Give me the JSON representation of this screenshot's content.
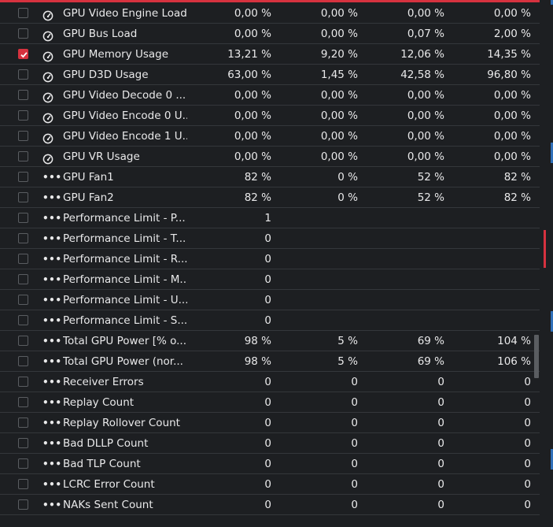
{
  "colors": {
    "accent": "#d6323f",
    "background": "#1d1f22",
    "divider": "#34373b",
    "marker_blue": "#2f6fb8"
  },
  "rows": [
    {
      "checked": false,
      "icon": "gauge-icon",
      "name": "GPU Video Engine Load",
      "v1": "0,00 %",
      "v2": "0,00 %",
      "v3": "0,00 %",
      "v4": "0,00 %"
    },
    {
      "checked": false,
      "icon": "gauge-icon",
      "name": "GPU Bus Load",
      "v1": "0,00 %",
      "v2": "0,00 %",
      "v3": "0,07 %",
      "v4": "2,00 %"
    },
    {
      "checked": true,
      "icon": "gauge-icon",
      "name": "GPU Memory Usage",
      "v1": "13,21 %",
      "v2": "9,20 %",
      "v3": "12,06 %",
      "v4": "14,35 %"
    },
    {
      "checked": false,
      "icon": "gauge-icon",
      "name": "GPU D3D Usage",
      "v1": "63,00 %",
      "v2": "1,45 %",
      "v3": "42,58 %",
      "v4": "96,80 %"
    },
    {
      "checked": false,
      "icon": "gauge-icon",
      "name": "GPU Video Decode 0 ...",
      "v1": "0,00 %",
      "v2": "0,00 %",
      "v3": "0,00 %",
      "v4": "0,00 %"
    },
    {
      "checked": false,
      "icon": "gauge-icon",
      "name": "GPU Video Encode 0 U...",
      "v1": "0,00 %",
      "v2": "0,00 %",
      "v3": "0,00 %",
      "v4": "0,00 %"
    },
    {
      "checked": false,
      "icon": "gauge-icon",
      "name": "GPU Video Encode 1 U...",
      "v1": "0,00 %",
      "v2": "0,00 %",
      "v3": "0,00 %",
      "v4": "0,00 %"
    },
    {
      "checked": false,
      "icon": "gauge-icon",
      "name": "GPU VR Usage",
      "v1": "0,00 %",
      "v2": "0,00 %",
      "v3": "0,00 %",
      "v4": "0,00 %"
    },
    {
      "checked": false,
      "icon": "more-icon",
      "name": "GPU Fan1",
      "v1": "82 %",
      "v2": "0 %",
      "v3": "52 %",
      "v4": "82 %"
    },
    {
      "checked": false,
      "icon": "more-icon",
      "name": "GPU Fan2",
      "v1": "82 %",
      "v2": "0 %",
      "v3": "52 %",
      "v4": "82 %"
    },
    {
      "checked": false,
      "icon": "more-icon",
      "name": "Performance Limit - P...",
      "v1": "1",
      "v2": "",
      "v3": "",
      "v4": ""
    },
    {
      "checked": false,
      "icon": "more-icon",
      "name": "Performance Limit - T...",
      "v1": "0",
      "v2": "",
      "v3": "",
      "v4": ""
    },
    {
      "checked": false,
      "icon": "more-icon",
      "name": "Performance Limit - R...",
      "v1": "0",
      "v2": "",
      "v3": "",
      "v4": ""
    },
    {
      "checked": false,
      "icon": "more-icon",
      "name": "Performance Limit - M...",
      "v1": "0",
      "v2": "",
      "v3": "",
      "v4": ""
    },
    {
      "checked": false,
      "icon": "more-icon",
      "name": "Performance Limit - U...",
      "v1": "0",
      "v2": "",
      "v3": "",
      "v4": ""
    },
    {
      "checked": false,
      "icon": "more-icon",
      "name": "Performance Limit - S...",
      "v1": "0",
      "v2": "",
      "v3": "",
      "v4": ""
    },
    {
      "checked": false,
      "icon": "more-icon",
      "name": "Total GPU Power [% o...",
      "v1": "98 %",
      "v2": "5 %",
      "v3": "69 %",
      "v4": "104 %"
    },
    {
      "checked": false,
      "icon": "more-icon",
      "name": "Total GPU Power (nor...",
      "v1": "98 %",
      "v2": "5 %",
      "v3": "69 %",
      "v4": "106 %"
    },
    {
      "checked": false,
      "icon": "more-icon",
      "name": "Receiver Errors",
      "v1": "0",
      "v2": "0",
      "v3": "0",
      "v4": "0"
    },
    {
      "checked": false,
      "icon": "more-icon",
      "name": "Replay Count",
      "v1": "0",
      "v2": "0",
      "v3": "0",
      "v4": "0"
    },
    {
      "checked": false,
      "icon": "more-icon",
      "name": "Replay Rollover Count",
      "v1": "0",
      "v2": "0",
      "v3": "0",
      "v4": "0"
    },
    {
      "checked": false,
      "icon": "more-icon",
      "name": "Bad DLLP Count",
      "v1": "0",
      "v2": "0",
      "v3": "0",
      "v4": "0"
    },
    {
      "checked": false,
      "icon": "more-icon",
      "name": "Bad TLP Count",
      "v1": "0",
      "v2": "0",
      "v3": "0",
      "v4": "0"
    },
    {
      "checked": false,
      "icon": "more-icon",
      "name": "LCRC Error Count",
      "v1": "0",
      "v2": "0",
      "v3": "0",
      "v4": "0"
    },
    {
      "checked": false,
      "icon": "more-icon",
      "name": "NAKs Sent Count",
      "v1": "0",
      "v2": "0",
      "v3": "0",
      "v4": "0"
    }
  ]
}
